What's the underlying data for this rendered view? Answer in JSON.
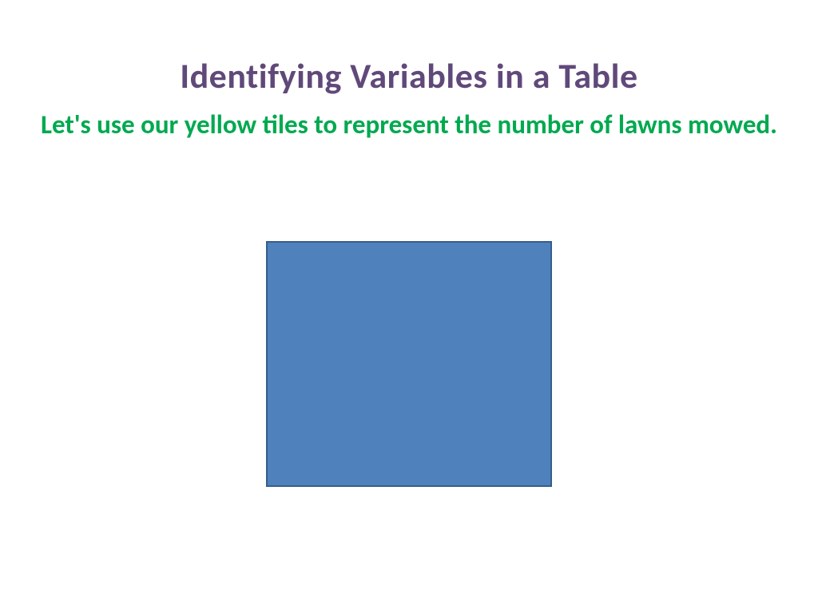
{
  "slide": {
    "title": "Identifying Variables in a Table",
    "subtitle": "Let's use our yellow tiles to represent the number of lawns mowed."
  },
  "colors": {
    "title_color": "#60497a",
    "subtitle_color": "#00a94f",
    "tile_fill": "#4f81bd",
    "tile_border": "#385d8a"
  }
}
